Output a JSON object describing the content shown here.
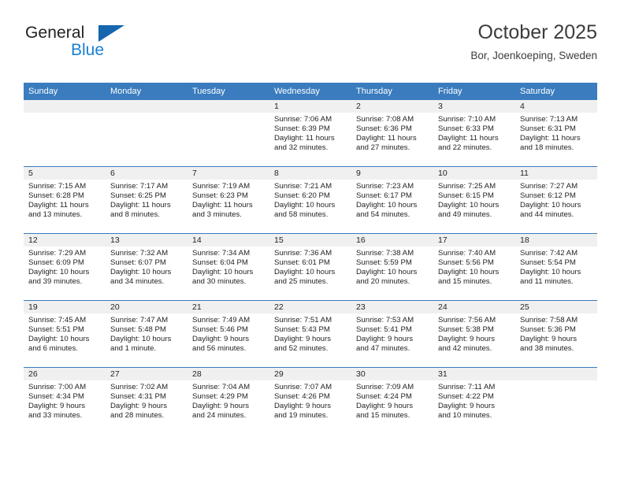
{
  "brand": {
    "name_part1": "General",
    "name_part2": "Blue",
    "accent_color": "#1a7fd4",
    "triangle_color": "#1566ad"
  },
  "header": {
    "title": "October 2025",
    "location": "Bor, Joenkoeping, Sweden"
  },
  "calendar": {
    "header_color": "#3a7cbe",
    "daynum_strip_color": "#f0f0f0",
    "weekday_headers": [
      "Sunday",
      "Monday",
      "Tuesday",
      "Wednesday",
      "Thursday",
      "Friday",
      "Saturday"
    ],
    "weeks": [
      [
        {
          "day": "",
          "empty": true
        },
        {
          "day": "",
          "empty": true
        },
        {
          "day": "",
          "empty": true
        },
        {
          "day": "1",
          "sunrise": "Sunrise: 7:06 AM",
          "sunset": "Sunset: 6:39 PM",
          "daylight_line1": "Daylight: 11 hours",
          "daylight_line2": "and 32 minutes."
        },
        {
          "day": "2",
          "sunrise": "Sunrise: 7:08 AM",
          "sunset": "Sunset: 6:36 PM",
          "daylight_line1": "Daylight: 11 hours",
          "daylight_line2": "and 27 minutes."
        },
        {
          "day": "3",
          "sunrise": "Sunrise: 7:10 AM",
          "sunset": "Sunset: 6:33 PM",
          "daylight_line1": "Daylight: 11 hours",
          "daylight_line2": "and 22 minutes."
        },
        {
          "day": "4",
          "sunrise": "Sunrise: 7:13 AM",
          "sunset": "Sunset: 6:31 PM",
          "daylight_line1": "Daylight: 11 hours",
          "daylight_line2": "and 18 minutes."
        }
      ],
      [
        {
          "day": "5",
          "sunrise": "Sunrise: 7:15 AM",
          "sunset": "Sunset: 6:28 PM",
          "daylight_line1": "Daylight: 11 hours",
          "daylight_line2": "and 13 minutes."
        },
        {
          "day": "6",
          "sunrise": "Sunrise: 7:17 AM",
          "sunset": "Sunset: 6:25 PM",
          "daylight_line1": "Daylight: 11 hours",
          "daylight_line2": "and 8 minutes."
        },
        {
          "day": "7",
          "sunrise": "Sunrise: 7:19 AM",
          "sunset": "Sunset: 6:23 PM",
          "daylight_line1": "Daylight: 11 hours",
          "daylight_line2": "and 3 minutes."
        },
        {
          "day": "8",
          "sunrise": "Sunrise: 7:21 AM",
          "sunset": "Sunset: 6:20 PM",
          "daylight_line1": "Daylight: 10 hours",
          "daylight_line2": "and 58 minutes."
        },
        {
          "day": "9",
          "sunrise": "Sunrise: 7:23 AM",
          "sunset": "Sunset: 6:17 PM",
          "daylight_line1": "Daylight: 10 hours",
          "daylight_line2": "and 54 minutes."
        },
        {
          "day": "10",
          "sunrise": "Sunrise: 7:25 AM",
          "sunset": "Sunset: 6:15 PM",
          "daylight_line1": "Daylight: 10 hours",
          "daylight_line2": "and 49 minutes."
        },
        {
          "day": "11",
          "sunrise": "Sunrise: 7:27 AM",
          "sunset": "Sunset: 6:12 PM",
          "daylight_line1": "Daylight: 10 hours",
          "daylight_line2": "and 44 minutes."
        }
      ],
      [
        {
          "day": "12",
          "sunrise": "Sunrise: 7:29 AM",
          "sunset": "Sunset: 6:09 PM",
          "daylight_line1": "Daylight: 10 hours",
          "daylight_line2": "and 39 minutes."
        },
        {
          "day": "13",
          "sunrise": "Sunrise: 7:32 AM",
          "sunset": "Sunset: 6:07 PM",
          "daylight_line1": "Daylight: 10 hours",
          "daylight_line2": "and 34 minutes."
        },
        {
          "day": "14",
          "sunrise": "Sunrise: 7:34 AM",
          "sunset": "Sunset: 6:04 PM",
          "daylight_line1": "Daylight: 10 hours",
          "daylight_line2": "and 30 minutes."
        },
        {
          "day": "15",
          "sunrise": "Sunrise: 7:36 AM",
          "sunset": "Sunset: 6:01 PM",
          "daylight_line1": "Daylight: 10 hours",
          "daylight_line2": "and 25 minutes."
        },
        {
          "day": "16",
          "sunrise": "Sunrise: 7:38 AM",
          "sunset": "Sunset: 5:59 PM",
          "daylight_line1": "Daylight: 10 hours",
          "daylight_line2": "and 20 minutes."
        },
        {
          "day": "17",
          "sunrise": "Sunrise: 7:40 AM",
          "sunset": "Sunset: 5:56 PM",
          "daylight_line1": "Daylight: 10 hours",
          "daylight_line2": "and 15 minutes."
        },
        {
          "day": "18",
          "sunrise": "Sunrise: 7:42 AM",
          "sunset": "Sunset: 5:54 PM",
          "daylight_line1": "Daylight: 10 hours",
          "daylight_line2": "and 11 minutes."
        }
      ],
      [
        {
          "day": "19",
          "sunrise": "Sunrise: 7:45 AM",
          "sunset": "Sunset: 5:51 PM",
          "daylight_line1": "Daylight: 10 hours",
          "daylight_line2": "and 6 minutes."
        },
        {
          "day": "20",
          "sunrise": "Sunrise: 7:47 AM",
          "sunset": "Sunset: 5:48 PM",
          "daylight_line1": "Daylight: 10 hours",
          "daylight_line2": "and 1 minute."
        },
        {
          "day": "21",
          "sunrise": "Sunrise: 7:49 AM",
          "sunset": "Sunset: 5:46 PM",
          "daylight_line1": "Daylight: 9 hours",
          "daylight_line2": "and 56 minutes."
        },
        {
          "day": "22",
          "sunrise": "Sunrise: 7:51 AM",
          "sunset": "Sunset: 5:43 PM",
          "daylight_line1": "Daylight: 9 hours",
          "daylight_line2": "and 52 minutes."
        },
        {
          "day": "23",
          "sunrise": "Sunrise: 7:53 AM",
          "sunset": "Sunset: 5:41 PM",
          "daylight_line1": "Daylight: 9 hours",
          "daylight_line2": "and 47 minutes."
        },
        {
          "day": "24",
          "sunrise": "Sunrise: 7:56 AM",
          "sunset": "Sunset: 5:38 PM",
          "daylight_line1": "Daylight: 9 hours",
          "daylight_line2": "and 42 minutes."
        },
        {
          "day": "25",
          "sunrise": "Sunrise: 7:58 AM",
          "sunset": "Sunset: 5:36 PM",
          "daylight_line1": "Daylight: 9 hours",
          "daylight_line2": "and 38 minutes."
        }
      ],
      [
        {
          "day": "26",
          "sunrise": "Sunrise: 7:00 AM",
          "sunset": "Sunset: 4:34 PM",
          "daylight_line1": "Daylight: 9 hours",
          "daylight_line2": "and 33 minutes."
        },
        {
          "day": "27",
          "sunrise": "Sunrise: 7:02 AM",
          "sunset": "Sunset: 4:31 PM",
          "daylight_line1": "Daylight: 9 hours",
          "daylight_line2": "and 28 minutes."
        },
        {
          "day": "28",
          "sunrise": "Sunrise: 7:04 AM",
          "sunset": "Sunset: 4:29 PM",
          "daylight_line1": "Daylight: 9 hours",
          "daylight_line2": "and 24 minutes."
        },
        {
          "day": "29",
          "sunrise": "Sunrise: 7:07 AM",
          "sunset": "Sunset: 4:26 PM",
          "daylight_line1": "Daylight: 9 hours",
          "daylight_line2": "and 19 minutes."
        },
        {
          "day": "30",
          "sunrise": "Sunrise: 7:09 AM",
          "sunset": "Sunset: 4:24 PM",
          "daylight_line1": "Daylight: 9 hours",
          "daylight_line2": "and 15 minutes."
        },
        {
          "day": "31",
          "sunrise": "Sunrise: 7:11 AM",
          "sunset": "Sunset: 4:22 PM",
          "daylight_line1": "Daylight: 9 hours",
          "daylight_line2": "and 10 minutes."
        },
        {
          "day": "",
          "empty": true
        }
      ]
    ]
  }
}
